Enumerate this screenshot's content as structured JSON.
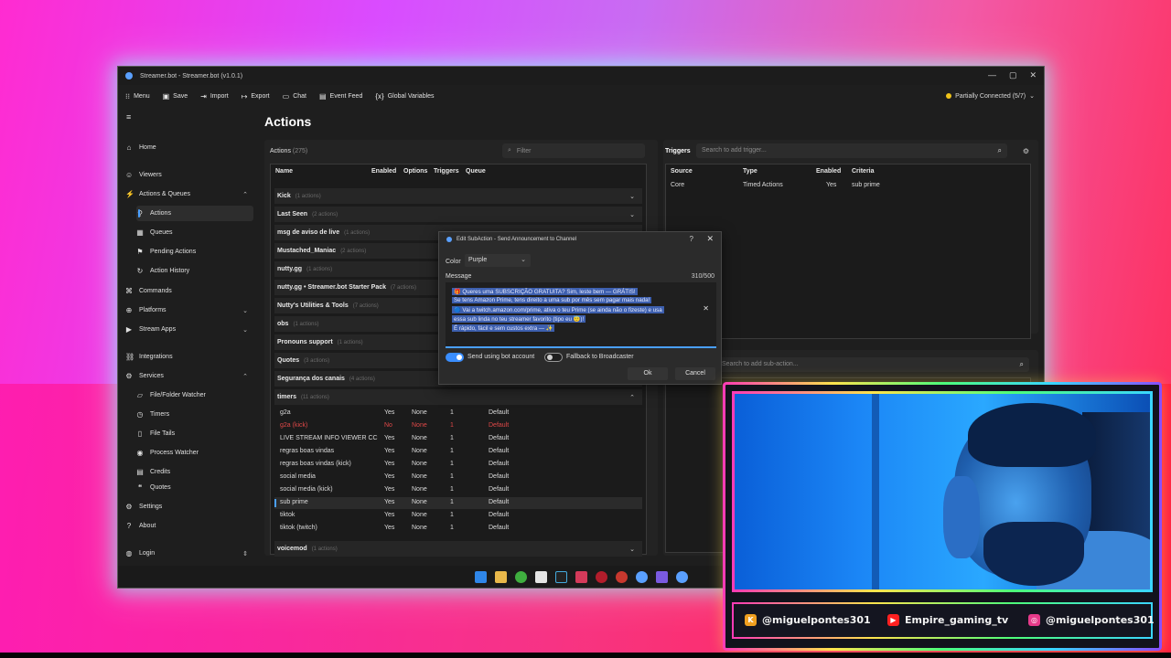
{
  "app": {
    "title": "Streamer.bot - Streamer.bot (v1.0.1)",
    "connection": "Partially Connected (5/7)",
    "page_title": "Actions"
  },
  "toolbar": [
    {
      "label": "Menu",
      "icon": "grid-icon"
    },
    {
      "label": "Save",
      "icon": "save-icon"
    },
    {
      "label": "Import",
      "icon": "import-icon"
    },
    {
      "label": "Export",
      "icon": "export-icon"
    },
    {
      "label": "Chat",
      "icon": "chat-icon"
    },
    {
      "label": "Event Feed",
      "icon": "event-feed-icon"
    },
    {
      "label": "Global Variables",
      "icon": "variables-icon"
    }
  ],
  "sidebar": {
    "items": [
      {
        "label": "Home",
        "icon": "home-icon"
      },
      {
        "label": "Viewers",
        "icon": "viewers-icon"
      },
      {
        "label": "Actions & Queues",
        "icon": "actions-icon"
      },
      {
        "label": "Actions",
        "icon": "action-icon"
      },
      {
        "label": "Queues",
        "icon": "queues-icon"
      },
      {
        "label": "Pending Actions",
        "icon": "pending-icon"
      },
      {
        "label": "Action History",
        "icon": "history-icon"
      },
      {
        "label": "Commands",
        "icon": "commands-icon"
      },
      {
        "label": "Platforms",
        "icon": "platforms-icon"
      },
      {
        "label": "Stream Apps",
        "icon": "stream-apps-icon"
      },
      {
        "label": "Integrations",
        "icon": "integrations-icon"
      },
      {
        "label": "Services",
        "icon": "services-icon"
      },
      {
        "label": "File/Folder Watcher",
        "icon": "folder-icon"
      },
      {
        "label": "Timers",
        "icon": "timer-icon"
      },
      {
        "label": "File Tails",
        "icon": "file-icon"
      },
      {
        "label": "Process Watcher",
        "icon": "process-icon"
      },
      {
        "label": "Credits",
        "icon": "credits-icon"
      },
      {
        "label": "Quotes",
        "icon": "quotes-icon"
      },
      {
        "label": "Settings",
        "icon": "gear-icon"
      },
      {
        "label": "About",
        "icon": "help-icon"
      },
      {
        "label": "Login",
        "icon": "user-icon"
      }
    ]
  },
  "actions": {
    "header": "Actions",
    "count": "(275)",
    "filter_placeholder": "Filter",
    "columns": [
      "Name",
      "Enabled",
      "Options",
      "Triggers",
      "Queue"
    ],
    "groups": [
      {
        "name": "Kick",
        "count": "(1 actions)"
      },
      {
        "name": "Last Seen",
        "count": "(2 actions)"
      },
      {
        "name": "msg de aviso de live",
        "count": "(1 actions)"
      },
      {
        "name": "Mustached_Maniac",
        "count": "(2 actions)"
      },
      {
        "name": "nutty.gg",
        "count": "(1 actions)"
      },
      {
        "name": "nutty.gg • Streamer.bot Starter Pack",
        "count": "(7 actions)"
      },
      {
        "name": "Nutty's Utilities & Tools",
        "count": "(7 actions)"
      },
      {
        "name": "obs",
        "count": "(1 actions)"
      },
      {
        "name": "Pronouns support",
        "count": "(1 actions)"
      },
      {
        "name": "Quotes",
        "count": "(3 actions)"
      },
      {
        "name": "Segurança dos canais",
        "count": "(4 actions)"
      },
      {
        "name": "timers",
        "count": "(11 actions)"
      }
    ],
    "timer_rows": [
      {
        "name": "g2a",
        "enabled": "Yes",
        "options": "None",
        "triggers": "1",
        "queue": "Default",
        "disabled": false
      },
      {
        "name": "g2a (kick)",
        "enabled": "No",
        "options": "None",
        "triggers": "1",
        "queue": "Default",
        "disabled": true
      },
      {
        "name": "LIVE STREAM INFO VIEWER CC",
        "enabled": "Yes",
        "options": "None",
        "triggers": "1",
        "queue": "Default",
        "disabled": false
      },
      {
        "name": "regras boas vindas",
        "enabled": "Yes",
        "options": "None",
        "triggers": "1",
        "queue": "Default",
        "disabled": false
      },
      {
        "name": "regras boas vindas  (kick)",
        "enabled": "Yes",
        "options": "None",
        "triggers": "1",
        "queue": "Default",
        "disabled": false
      },
      {
        "name": "social media",
        "enabled": "Yes",
        "options": "None",
        "triggers": "1",
        "queue": "Default",
        "disabled": false
      },
      {
        "name": "social media  (kick)",
        "enabled": "Yes",
        "options": "None",
        "triggers": "1",
        "queue": "Default",
        "disabled": false
      },
      {
        "name": "sub prime",
        "enabled": "Yes",
        "options": "None",
        "triggers": "1",
        "queue": "Default",
        "disabled": false
      },
      {
        "name": "tiktok",
        "enabled": "Yes",
        "options": "None",
        "triggers": "1",
        "queue": "Default",
        "disabled": false
      },
      {
        "name": "tiktok (twitch)",
        "enabled": "Yes",
        "options": "None",
        "triggers": "1",
        "queue": "Default",
        "disabled": false
      }
    ],
    "last_group": {
      "name": "voicemod",
      "count": "(1 actions)"
    }
  },
  "triggers": {
    "header": "Triggers",
    "search_placeholder": "Search to add trigger...",
    "columns": [
      "Source",
      "Type",
      "Enabled",
      "Criteria"
    ],
    "row": {
      "source": "Core",
      "type": "Timed Actions",
      "enabled": "Yes",
      "criteria": "sub prime"
    }
  },
  "subactions": {
    "search_placeholder": "Search to add sub-action..."
  },
  "dialog": {
    "title": "Edit SubAction - Send Announcement to Channel",
    "color_label": "Color",
    "color_value": "Purple",
    "message_label": "Message",
    "message_count": "310/500",
    "message_lines": [
      "🎁 Queres uma SUBSCRIÇÃO GRATUITA? Sim, leste bem — GRÁTIS!",
      "Se tens Amazon Prime, tens direito a uma sub por mês sem pagar mais nada!",
      "🔵 Vai a twitch.amazon.com/prime, ativa o teu Prime (se ainda não o fizeste) e usa",
      "essa sub linda no teu streamer favorito (tipo eu 😇)!",
      "É rápido, fácil e sem custos extra — ✨"
    ],
    "toggle_bot_label": "Send using bot account",
    "toggle_bot_on": true,
    "toggle_fallback_label": "Fallback to Broadcaster",
    "toggle_fallback_on": false,
    "ok_label": "Ok",
    "cancel_label": "Cancel"
  },
  "overlay": {
    "socials": [
      {
        "handle": "@miguelpontes301",
        "icon": "kick-icon",
        "color": "#f0a020"
      },
      {
        "handle": "Empire_gaming_tv",
        "icon": "youtube-icon",
        "color": "#ff2020"
      },
      {
        "handle": "@miguelpontes301",
        "icon": "instagram-icon",
        "color": "#e63a8a"
      }
    ]
  },
  "colors": {
    "accent": "#4aa0ff",
    "disabled_text": "#e04848"
  }
}
